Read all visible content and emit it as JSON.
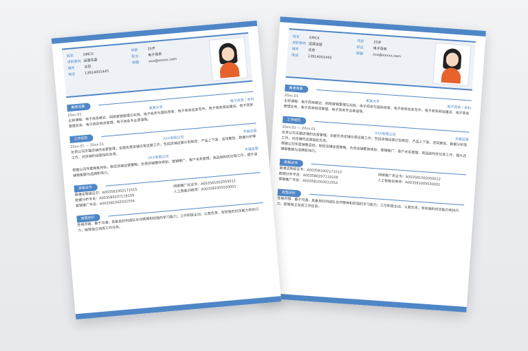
{
  "resume": {
    "name": "GMCX",
    "age": "25岁",
    "phone": "13914001445",
    "email": "xxx@xxxxx.com",
    "target_city": "北京",
    "job_target": "运营总监",
    "status": "求职意向",
    "exp_label": "现任公司",
    "education": "本科",
    "career": "电子商务"
  },
  "sections": {
    "edu": "教育背景",
    "work": "工作经历",
    "cert": "资格证书",
    "self": "自我评价"
  },
  "front": {
    "edu_date": "20xx.01",
    "edu_school": "某某大学",
    "edu_major": "电子商务 / 本科",
    "edu_text": "主修课程：电子商务概论、网络营销管理与实践、电子商务与国际贸易、电子商务信息写作、电子商务网站建设、电子商务管理实务、电子商务物流管理、电子商务专业英语等。",
    "job1_date": "20xx.01 — 20xx.01",
    "job1_company": "XXX有限公司",
    "job1_role": "天猫运营",
    "job1_text": "负责公司天猫店铺的运营管理，全面负责店铺日常运营工作，包括店铺运营计划制定、产品上下架、活动策划、数据分析等工作，对店铺的运营指标负责。",
    "job2_company": "XXX有限公司",
    "job2_role": "天猫运营",
    "job2_text": "根据公司年度销售目标，制定店铺运营策略，负责店铺整体规划、营销推广、客户关系管理、商品结构优化等工作，提升店铺销售额与品牌影响力。",
    "certs": [
      "普通话等级证书：A003581002171515",
      "数据分析专员：A003580207119109",
      "营销推广专员：A003581002031554",
      "网络推广员证书：A003581002050012",
      "人工智能训练师：A003581005030001"
    ],
    "self_text": "性格开朗、善于沟通，具备良好的团队合作精神和较强的学习能力；工作积极主动、认真负责，有较强的抗压能力和执行力，能够独立完成工作任务。"
  },
  "back": {
    "edu_major": "电子商务 / 本科",
    "job_company": "XXX有限公司",
    "job_role": "天猫运营"
  }
}
